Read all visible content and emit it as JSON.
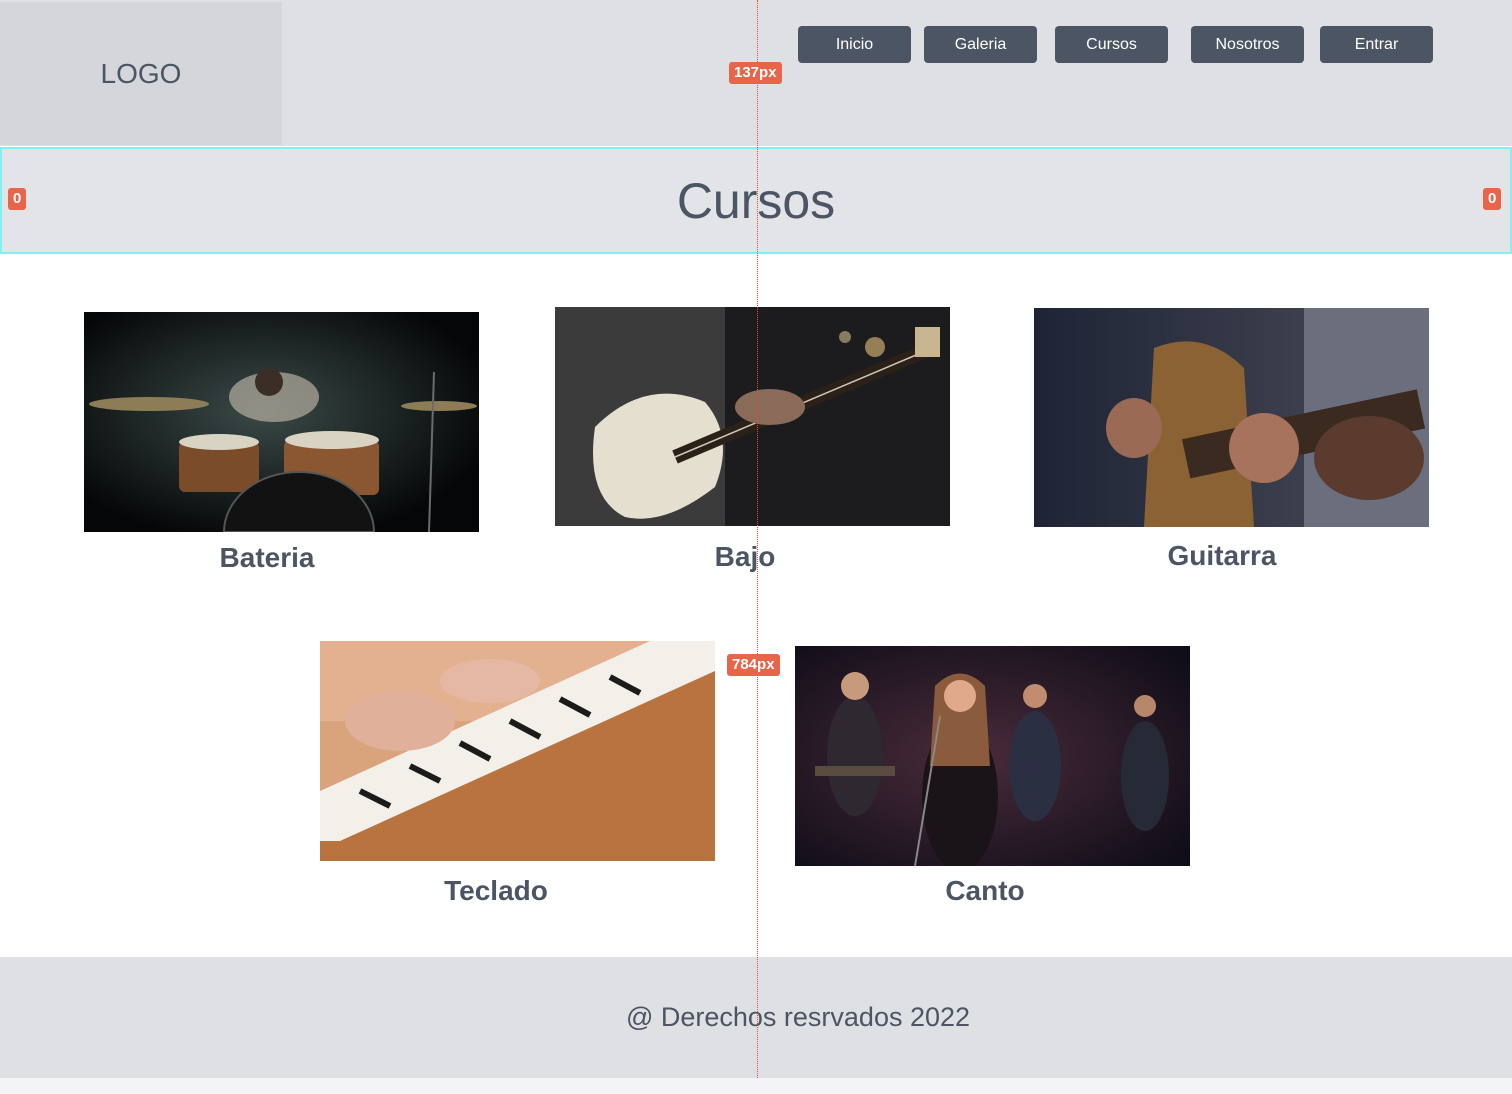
{
  "header": {
    "logo": "LOGO",
    "nav": [
      {
        "label": "Inicio"
      },
      {
        "label": "Galeria"
      },
      {
        "label": "Cursos"
      },
      {
        "label": "Nosotros"
      },
      {
        "label": "Entrar"
      }
    ]
  },
  "inspector": {
    "guide_top_label": "137px",
    "guide_bottom_label": "784px",
    "left_margin_label": "0",
    "right_margin_label": "0"
  },
  "page": {
    "title": "Cursos"
  },
  "courses": [
    {
      "label": "Bateria",
      "photo": "drummer-photo"
    },
    {
      "label": "Bajo",
      "photo": "bass-guitar-photo"
    },
    {
      "label": "Guitarra",
      "photo": "acoustic-guitar-photo"
    },
    {
      "label": "Teclado",
      "photo": "keyboard-photo"
    },
    {
      "label": "Canto",
      "photo": "singer-band-photo"
    }
  ],
  "footer": {
    "text": "@ Derechos resrvados 2022"
  },
  "colors": {
    "header_bg": "#dfe0e4",
    "nav_button_bg": "#4b5563",
    "title_border": "#7ff0f4",
    "badge": "#e8654a"
  }
}
